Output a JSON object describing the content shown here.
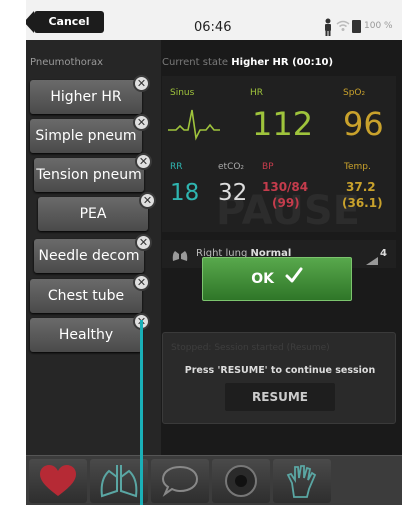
{
  "status_bar": {
    "cancel_label": "Cancel",
    "time": "06:46",
    "battery": "100 %"
  },
  "scenario": {
    "label": "Pneumothorax",
    "steps": [
      "Higher HR",
      "Simple pneum",
      "Tension pneum",
      "PEA",
      "Needle decom",
      "Chest tube",
      "Healthy"
    ]
  },
  "state": {
    "label": "Current state",
    "value": "Higher HR (00:10)"
  },
  "vitals": {
    "sinus_label": "Sinus",
    "hr_label": "HR",
    "hr": "112",
    "spo2_label": "SpO₂",
    "spo2": "96",
    "rr_label": "RR",
    "rr": "18",
    "etco2_label": "etCO₂",
    "etco2": "32",
    "bp_label": "BP",
    "bp": "130/84",
    "bp_mean": "(99)",
    "temp_label": "Temp.",
    "temp": "37.2",
    "temp_sub": "(36.1)",
    "pause_watermark": "PAUSE"
  },
  "lung": {
    "text": "Right lung",
    "status": "Normal",
    "level": "4"
  },
  "popup": {
    "ok_label": "OK"
  },
  "session": {
    "message_faded": "Stopped: Session started (Resume)",
    "prompt": "Press 'RESUME' to continue session",
    "resume_label": "RESUME"
  },
  "colors": {
    "hr": "#9fc43c",
    "spo2": "#c9a22c",
    "rr": "#2fb5b0",
    "bp": "#c43c4c",
    "temp": "#c9a22c",
    "ok": "#3f8e36",
    "callout": "#1ab0b8"
  },
  "icons": [
    "heart-icon",
    "lungs-icon",
    "speech-bubble-icon",
    "speaker-icon",
    "glove-icon"
  ]
}
